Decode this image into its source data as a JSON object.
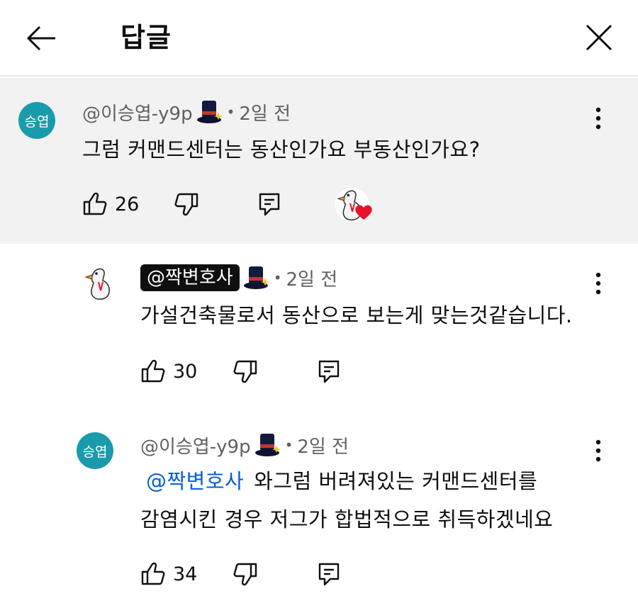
{
  "header": {
    "title": "답글",
    "back_icon": "arrow-left-icon",
    "close_icon": "close-icon"
  },
  "colors": {
    "avatar_bg": "#1a9bab",
    "mention": "#065fd4",
    "heart": "#e8102b",
    "highlight_bg": "#f2f2f2"
  },
  "comments": [
    {
      "avatar_text": "승엽",
      "author": "@이승엽-y9p",
      "time": "2일 전",
      "text": "그럼 커맨드센터는 동산인가요 부동산인가요?",
      "likes": "26",
      "creator_hearted": true
    },
    {
      "author": "@짝변호사",
      "time": "2일 전",
      "text": "가설건축물로서 동산으로 보는게 맞는것같습니다.",
      "likes": "30"
    },
    {
      "avatar_text": "승엽",
      "author": "@이승엽-y9p",
      "time": "2일 전",
      "mention": "@짝변호사",
      "text_line1": "와그럼 버려져있는 커맨드센터를",
      "text_line2": "감염시킨 경우 저그가 합법적으로 취득하겠네요",
      "likes": "34"
    }
  ],
  "separator": "•"
}
